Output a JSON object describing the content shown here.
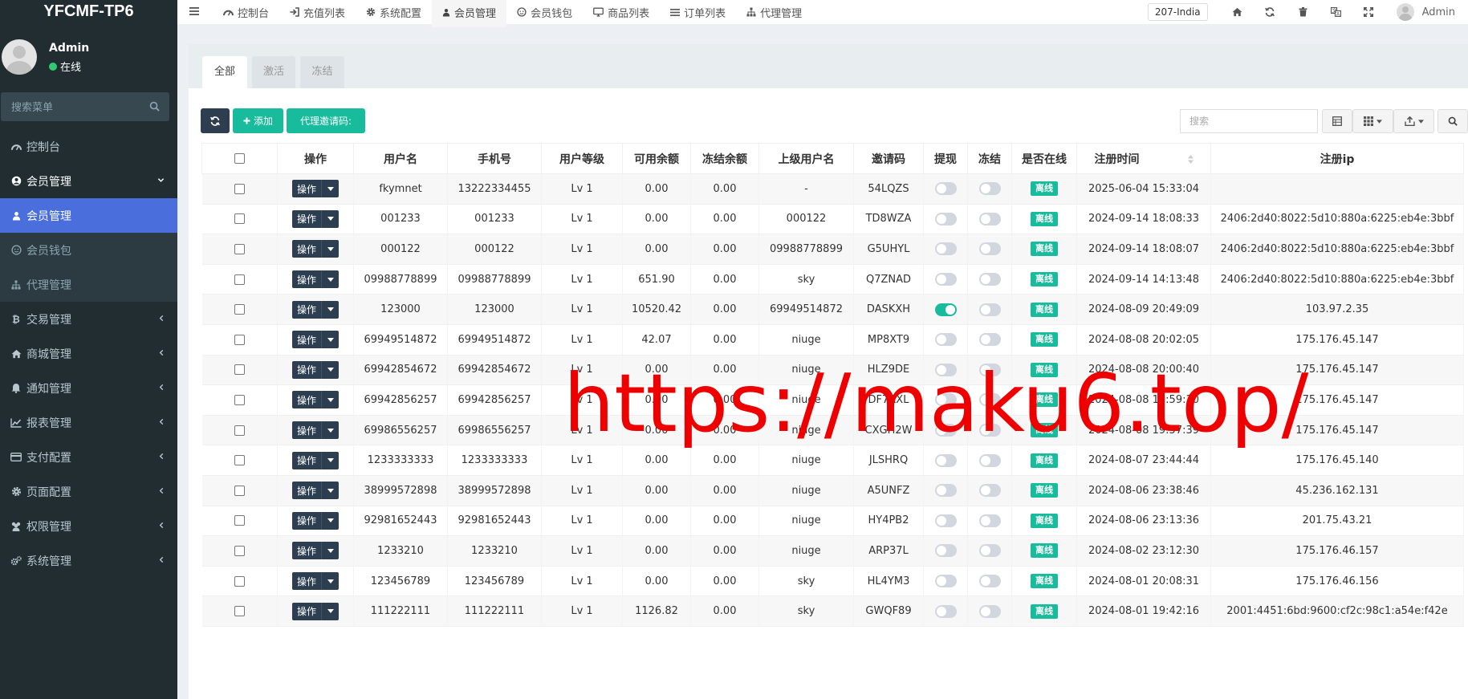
{
  "brand": "YFCMF-TP6",
  "user_panel": {
    "name": "Admin",
    "status": "在线"
  },
  "sidebar": {
    "search_placeholder": "搜索菜单",
    "items": [
      {
        "label": "控制台",
        "icon": "dashboard-icon"
      },
      {
        "label": "会员管理",
        "icon": "user-circle-icon"
      },
      {
        "label": "会员管理",
        "icon": "user-icon"
      },
      {
        "label": "会员钱包",
        "icon": "wallet-icon"
      },
      {
        "label": "代理管理",
        "icon": "sitemap-icon"
      },
      {
        "label": "交易管理",
        "icon": "bitcoin-icon"
      },
      {
        "label": "商城管理",
        "icon": "home-icon"
      },
      {
        "label": "通知管理",
        "icon": "bell-icon"
      },
      {
        "label": "报表管理",
        "icon": "line-chart-icon"
      },
      {
        "label": "支付配置",
        "icon": "credit-card-icon"
      },
      {
        "label": "页面配置",
        "icon": "gear-icon"
      },
      {
        "label": "权限管理",
        "icon": "users-icon"
      },
      {
        "label": "系统管理",
        "icon": "cogs-icon"
      }
    ]
  },
  "header": {
    "nav": [
      {
        "label": "控制台",
        "icon": "dashboard-icon"
      },
      {
        "label": "充值列表",
        "icon": "sign-in-icon"
      },
      {
        "label": "系统配置",
        "icon": "gear-icon"
      },
      {
        "label": "会员管理",
        "icon": "user-icon"
      },
      {
        "label": "会员钱包",
        "icon": "wallet-icon"
      },
      {
        "label": "商品列表",
        "icon": "desktop-icon"
      },
      {
        "label": "订单列表",
        "icon": "list-icon"
      },
      {
        "label": "代理管理",
        "icon": "sitemap-icon"
      }
    ],
    "region": "207-India",
    "admin_name": "Admin"
  },
  "tabs": [
    "全部",
    "激活",
    "冻结"
  ],
  "toolbar": {
    "add_label": "添加",
    "invite_label": "代理邀请码:",
    "search_placeholder": "搜索"
  },
  "table": {
    "columns": [
      "操作",
      "用户名",
      "手机号",
      "用户等级",
      "可用余额",
      "冻结余额",
      "上级用户名",
      "邀请码",
      "提现",
      "冻结",
      "是否在线",
      "注册时间",
      "注册ip"
    ],
    "op_label": "操作",
    "status_label": "离线",
    "rows": [
      {
        "username": "fkymnet",
        "phone": "13222334455",
        "level": "Lv 1",
        "balance": "0.00",
        "frozen": "0.00",
        "parent": "-",
        "code": "54LQZS",
        "withdraw": false,
        "freeze": false,
        "time": "2025-06-04 15:33:04",
        "ip": ""
      },
      {
        "username": "001233",
        "phone": "001233",
        "level": "Lv 1",
        "balance": "0.00",
        "frozen": "0.00",
        "parent": "000122",
        "code": "TD8WZA",
        "withdraw": false,
        "freeze": false,
        "time": "2024-09-14 18:08:33",
        "ip": "2406:2d40:8022:5d10:880a:6225:eb4e:3bbf"
      },
      {
        "username": "000122",
        "phone": "000122",
        "level": "Lv 1",
        "balance": "0.00",
        "frozen": "0.00",
        "parent": "09988778899",
        "code": "G5UHYL",
        "withdraw": false,
        "freeze": false,
        "time": "2024-09-14 18:08:07",
        "ip": "2406:2d40:8022:5d10:880a:6225:eb4e:3bbf"
      },
      {
        "username": "09988778899",
        "phone": "09988778899",
        "level": "Lv 1",
        "balance": "651.90",
        "frozen": "0.00",
        "parent": "sky",
        "code": "Q7ZNAD",
        "withdraw": false,
        "freeze": false,
        "time": "2024-09-14 14:13:48",
        "ip": "2406:2d40:8022:5d10:880a:6225:eb4e:3bbf"
      },
      {
        "username": "123000",
        "phone": "123000",
        "level": "Lv 1",
        "balance": "10520.42",
        "frozen": "0.00",
        "parent": "69949514872",
        "code": "DASKXH",
        "withdraw": true,
        "freeze": false,
        "time": "2024-08-09 20:49:09",
        "ip": "103.97.2.35"
      },
      {
        "username": "69949514872",
        "phone": "69949514872",
        "level": "Lv 1",
        "balance": "42.07",
        "frozen": "0.00",
        "parent": "niuge",
        "code": "MP8XT9",
        "withdraw": false,
        "freeze": false,
        "time": "2024-08-08 20:02:05",
        "ip": "175.176.45.147"
      },
      {
        "username": "69942854672",
        "phone": "69942854672",
        "level": "Lv 1",
        "balance": "0.00",
        "frozen": "0.00",
        "parent": "niuge",
        "code": "HLZ9DE",
        "withdraw": false,
        "freeze": false,
        "time": "2024-08-08 20:00:40",
        "ip": "175.176.45.147"
      },
      {
        "username": "69942856257",
        "phone": "69942856257",
        "level": "Lv 1",
        "balance": "0.00",
        "frozen": "0.00",
        "parent": "niuge",
        "code": "DF7RXL",
        "withdraw": false,
        "freeze": false,
        "time": "2024-08-08 19:59:30",
        "ip": "175.176.45.147"
      },
      {
        "username": "69986556257",
        "phone": "69986556257",
        "level": "Lv 1",
        "balance": "0.00",
        "frozen": "0.00",
        "parent": "niuge",
        "code": "CXGH2W",
        "withdraw": false,
        "freeze": false,
        "time": "2024-08-08 19:57:39",
        "ip": "175.176.45.147"
      },
      {
        "username": "1233333333",
        "phone": "1233333333",
        "level": "Lv 1",
        "balance": "0.00",
        "frozen": "0.00",
        "parent": "niuge",
        "code": "JLSHRQ",
        "withdraw": false,
        "freeze": false,
        "time": "2024-08-07 23:44:44",
        "ip": "175.176.45.140"
      },
      {
        "username": "38999572898",
        "phone": "38999572898",
        "level": "Lv 1",
        "balance": "0.00",
        "frozen": "0.00",
        "parent": "niuge",
        "code": "A5UNFZ",
        "withdraw": false,
        "freeze": false,
        "time": "2024-08-06 23:38:46",
        "ip": "45.236.162.131"
      },
      {
        "username": "92981652443",
        "phone": "92981652443",
        "level": "Lv 1",
        "balance": "0.00",
        "frozen": "0.00",
        "parent": "niuge",
        "code": "HY4PB2",
        "withdraw": false,
        "freeze": false,
        "time": "2024-08-06 23:13:36",
        "ip": "201.75.43.21"
      },
      {
        "username": "1233210",
        "phone": "1233210",
        "level": "Lv 1",
        "balance": "0.00",
        "frozen": "0.00",
        "parent": "niuge",
        "code": "ARP37L",
        "withdraw": false,
        "freeze": false,
        "time": "2024-08-02 23:12:30",
        "ip": "175.176.46.157"
      },
      {
        "username": "123456789",
        "phone": "123456789",
        "level": "Lv 1",
        "balance": "0.00",
        "frozen": "0.00",
        "parent": "sky",
        "code": "HL4YM3",
        "withdraw": false,
        "freeze": false,
        "time": "2024-08-01 20:08:31",
        "ip": "175.176.46.156"
      },
      {
        "username": "111222111",
        "phone": "111222111",
        "level": "Lv 1",
        "balance": "1126.82",
        "frozen": "0.00",
        "parent": "sky",
        "code": "GWQF89",
        "withdraw": false,
        "freeze": false,
        "time": "2024-08-01 19:42:16",
        "ip": "2001:4451:6bd:9600:cf2c:98c1:a54e:f42e"
      }
    ]
  },
  "watermark": "https://maku6.top/",
  "colors": {
    "sidebar": "#222d32",
    "active": "#4a6fdc",
    "accent": "#18bc9c",
    "dark_button": "#2c3e50",
    "watermark": "#ee0000"
  }
}
